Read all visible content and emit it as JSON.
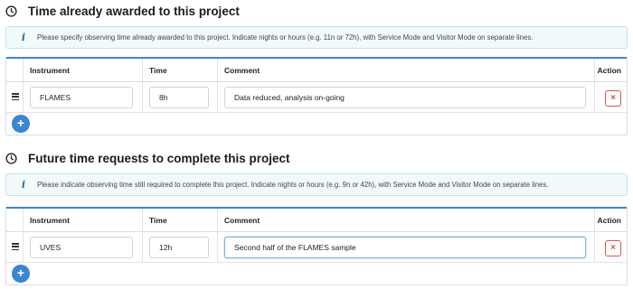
{
  "sections": [
    {
      "icon": "clock-icon",
      "title": "Time already awarded to this project",
      "info": "Please specify observing time already awarded to this project. Indicate nights or hours (e.g. 11n or 72h), with Service Mode and Visitor Mode on separate lines.",
      "columns": {
        "instrument": "Instrument",
        "time": "Time",
        "comment": "Comment",
        "action": "Action"
      },
      "rows": [
        {
          "instrument": "FLAMES",
          "time": "8h",
          "comment": "Data reduced, analysis on-going"
        }
      ],
      "remove_label": "×",
      "add_label": "+"
    },
    {
      "icon": "clock-icon",
      "title": "Future time requests to complete this project",
      "info": "Please indicate observing time still required to complete this project. Indicate nights or hours (e.g. 9n or 42h), with Service Mode and Visitor Mode on separate lines.",
      "columns": {
        "instrument": "Instrument",
        "time": "Time",
        "comment": "Comment",
        "action": "Action"
      },
      "rows": [
        {
          "instrument": "UVES",
          "time": "12h",
          "comment": "Second half of the FLAMES sample"
        }
      ],
      "remove_label": "×",
      "add_label": "+"
    }
  ],
  "colors": {
    "accent": "#3a86cf",
    "danger": "#d9534f",
    "info_bg": "#f1f9fb"
  }
}
